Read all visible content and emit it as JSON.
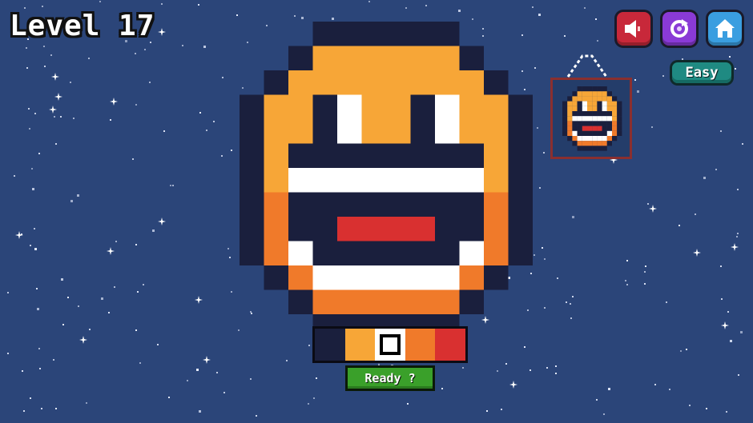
{
  "level": {
    "title": "Level 17"
  },
  "toolbar": {
    "sound_icon": "speaker-icon",
    "restart_icon": "restart-icon",
    "home_icon": "home-icon",
    "colors": {
      "sound": "#c8283a",
      "restart": "#8a3ad6",
      "home": "#3a9ee0"
    }
  },
  "difficulty": {
    "label": "Easy"
  },
  "palette": {
    "colors": [
      "#1a1f3d",
      "#f7a637",
      "#ffffff",
      "#f07a2a",
      "#d93030"
    ],
    "selected_index": 2
  },
  "ready_button": {
    "label": "Ready ?"
  },
  "pixel_art": {
    "legend": {
      "K": "#1a1f3d",
      "Y": "#f7a637",
      "W": "#ffffff",
      "O": "#f07a2a",
      "R": "#d93030",
      ".": "transparent"
    },
    "rows": [
      "...KKKKKK...",
      "..KYYYYYYK..",
      ".KYYYYYYYYK.",
      "KYYKWYYKWYYK",
      "KYYKWYYKWYYK",
      "KYKKKKKKKKYK",
      "KYWWWWWWWWYK",
      "KOKKKKKKKKOK",
      "KOKKRRRRKKOK",
      "KOWKKKKKKWOK",
      ".KOWWWWWWOK.",
      "..KOOOOOOK..",
      "...KKKKKK..."
    ]
  }
}
